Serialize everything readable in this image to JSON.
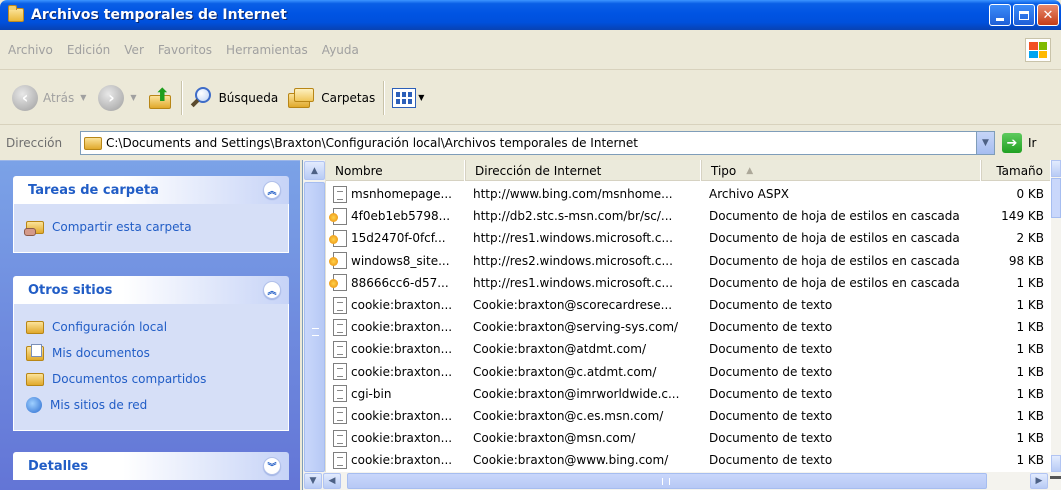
{
  "window": {
    "title": "Archivos temporales de Internet"
  },
  "menu": [
    "Archivo",
    "Edición",
    "Ver",
    "Favoritos",
    "Herramientas",
    "Ayuda"
  ],
  "toolbar": {
    "back_label": "Atrás",
    "search_label": "Búsqueda",
    "folders_label": "Carpetas"
  },
  "address": {
    "label": "Dirección",
    "value": "C:\\Documents and Settings\\Braxton\\Configuración local\\Archivos temporales de Internet",
    "go_label": "Ir"
  },
  "taskpane": {
    "folder_tasks": {
      "title": "Tareas de carpeta",
      "items": [
        "Compartir esta carpeta"
      ]
    },
    "other_places": {
      "title": "Otros sitios",
      "items": [
        "Configuración local",
        "Mis documentos",
        "Documentos compartidos",
        "Mis sitios de red"
      ]
    },
    "details": {
      "title": "Detalles"
    }
  },
  "columns": {
    "name": "Nombre",
    "address": "Dirección de Internet",
    "type": "Tipo",
    "size": "Tamaño"
  },
  "files": [
    {
      "icon": "aspx",
      "name": "msnhomepage...",
      "address": "http://www.bing.com/msnhome...",
      "type": "Archivo ASPX",
      "size": "0 KB"
    },
    {
      "icon": "css",
      "name": "4f0eb1eb5798...",
      "address": "http://db2.stc.s-msn.com/br/sc/...",
      "type": "Documento de hoja de estilos en cascada",
      "size": "149 KB"
    },
    {
      "icon": "css",
      "name": "15d2470f-0fcf...",
      "address": "http://res1.windows.microsoft.c...",
      "type": "Documento de hoja de estilos en cascada",
      "size": "2 KB"
    },
    {
      "icon": "css",
      "name": "windows8_site...",
      "address": "http://res2.windows.microsoft.c...",
      "type": "Documento de hoja de estilos en cascada",
      "size": "98 KB"
    },
    {
      "icon": "css",
      "name": "88666cc6-d57...",
      "address": "http://res1.windows.microsoft.c...",
      "type": "Documento de hoja de estilos en cascada",
      "size": "1 KB"
    },
    {
      "icon": "doc",
      "name": "cookie:braxton...",
      "address": "Cookie:braxton@scorecardrese...",
      "type": "Documento de texto",
      "size": "1 KB"
    },
    {
      "icon": "doc",
      "name": "cookie:braxton...",
      "address": "Cookie:braxton@serving-sys.com/",
      "type": "Documento de texto",
      "size": "1 KB"
    },
    {
      "icon": "doc",
      "name": "cookie:braxton...",
      "address": "Cookie:braxton@atdmt.com/",
      "type": "Documento de texto",
      "size": "1 KB"
    },
    {
      "icon": "doc",
      "name": "cookie:braxton...",
      "address": "Cookie:braxton@c.atdmt.com/",
      "type": "Documento de texto",
      "size": "1 KB"
    },
    {
      "icon": "doc",
      "name": "cgi-bin",
      "address": "Cookie:braxton@imrworldwide.c...",
      "type": "Documento de texto",
      "size": "1 KB"
    },
    {
      "icon": "doc",
      "name": "cookie:braxton...",
      "address": "Cookie:braxton@c.es.msn.com/",
      "type": "Documento de texto",
      "size": "1 KB"
    },
    {
      "icon": "doc",
      "name": "cookie:braxton...",
      "address": "Cookie:braxton@msn.com/",
      "type": "Documento de texto",
      "size": "1 KB"
    },
    {
      "icon": "doc",
      "name": "cookie:braxton...",
      "address": "Cookie:braxton@www.bing.com/",
      "type": "Documento de texto",
      "size": "1 KB"
    }
  ]
}
